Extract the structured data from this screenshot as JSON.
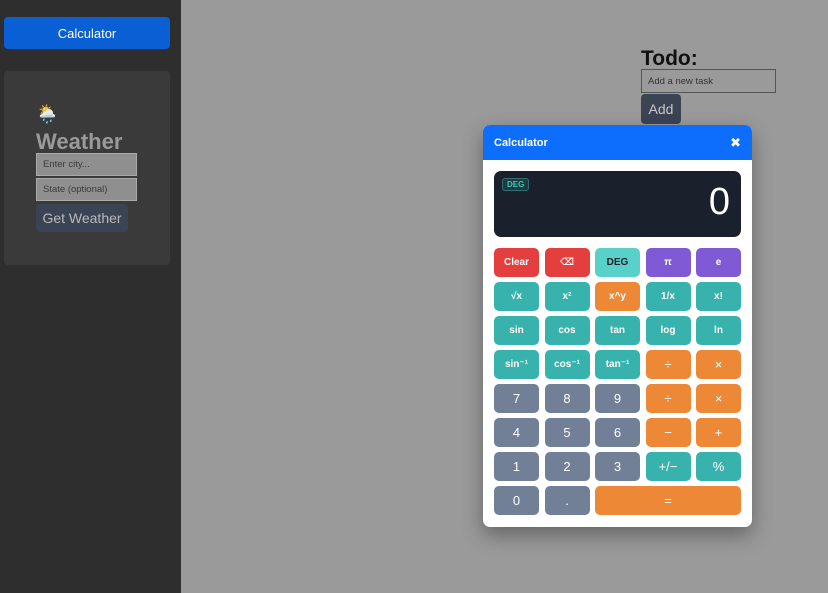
{
  "sidebar": {
    "calculator_label": "Calculator",
    "weather": {
      "icon": "cloud-rain-sun-icon",
      "title": "Weather",
      "city_placeholder": "Enter city...",
      "state_placeholder": "State (optional)",
      "button_label": "Get Weather"
    }
  },
  "todo": {
    "title": "Todo:",
    "input_placeholder": "Add a new task",
    "add_label": "Add"
  },
  "calculator": {
    "title": "Calculator",
    "close_icon": "close-icon",
    "mode_badge": "DEG",
    "display_value": "0",
    "keys": [
      {
        "label": "Clear",
        "name": "clear-button"
      },
      {
        "label": "⌫",
        "name": "backspace-button"
      },
      {
        "label": "DEG",
        "name": "deg-toggle-button"
      },
      {
        "label": "π",
        "name": "pi-button"
      },
      {
        "label": "e",
        "name": "e-button"
      },
      {
        "label": "√x",
        "name": "sqrt-button"
      },
      {
        "label": "x²",
        "name": "square-button"
      },
      {
        "label": "x^y",
        "name": "power-button"
      },
      {
        "label": "1/x",
        "name": "reciprocal-button"
      },
      {
        "label": "x!",
        "name": "factorial-button"
      },
      {
        "label": "sin",
        "name": "sin-button"
      },
      {
        "label": "cos",
        "name": "cos-button"
      },
      {
        "label": "tan",
        "name": "tan-button"
      },
      {
        "label": "log",
        "name": "log-button"
      },
      {
        "label": "ln",
        "name": "ln-button"
      },
      {
        "label": "sin⁻¹",
        "name": "asin-button"
      },
      {
        "label": "cos⁻¹",
        "name": "acos-button"
      },
      {
        "label": "tan⁻¹",
        "name": "atan-button"
      },
      {
        "label": "÷",
        "name": "divide-button-1"
      },
      {
        "label": "×",
        "name": "multiply-button-1"
      },
      {
        "label": "7",
        "name": "digit-7-button"
      },
      {
        "label": "8",
        "name": "digit-8-button"
      },
      {
        "label": "9",
        "name": "digit-9-button"
      },
      {
        "label": "÷",
        "name": "divide-button-2"
      },
      {
        "label": "×",
        "name": "multiply-button-2"
      },
      {
        "label": "4",
        "name": "digit-4-button"
      },
      {
        "label": "5",
        "name": "digit-5-button"
      },
      {
        "label": "6",
        "name": "digit-6-button"
      },
      {
        "label": "−",
        "name": "minus-button"
      },
      {
        "label": "+",
        "name": "plus-button"
      },
      {
        "label": "1",
        "name": "digit-1-button"
      },
      {
        "label": "2",
        "name": "digit-2-button"
      },
      {
        "label": "3",
        "name": "digit-3-button"
      },
      {
        "label": "+/−",
        "name": "sign-toggle-button"
      },
      {
        "label": "%",
        "name": "percent-button"
      },
      {
        "label": "0",
        "name": "digit-0-button"
      },
      {
        "label": ".",
        "name": "decimal-button"
      },
      {
        "label": "=",
        "name": "equals-button"
      }
    ]
  },
  "colors": {
    "header_blue": "#0d6efd",
    "display_bg": "#1a202c",
    "red": "#e53e3e",
    "teal": "#38b2ac",
    "purple": "#805ad5",
    "orange": "#ed8936",
    "gray": "#718096"
  }
}
